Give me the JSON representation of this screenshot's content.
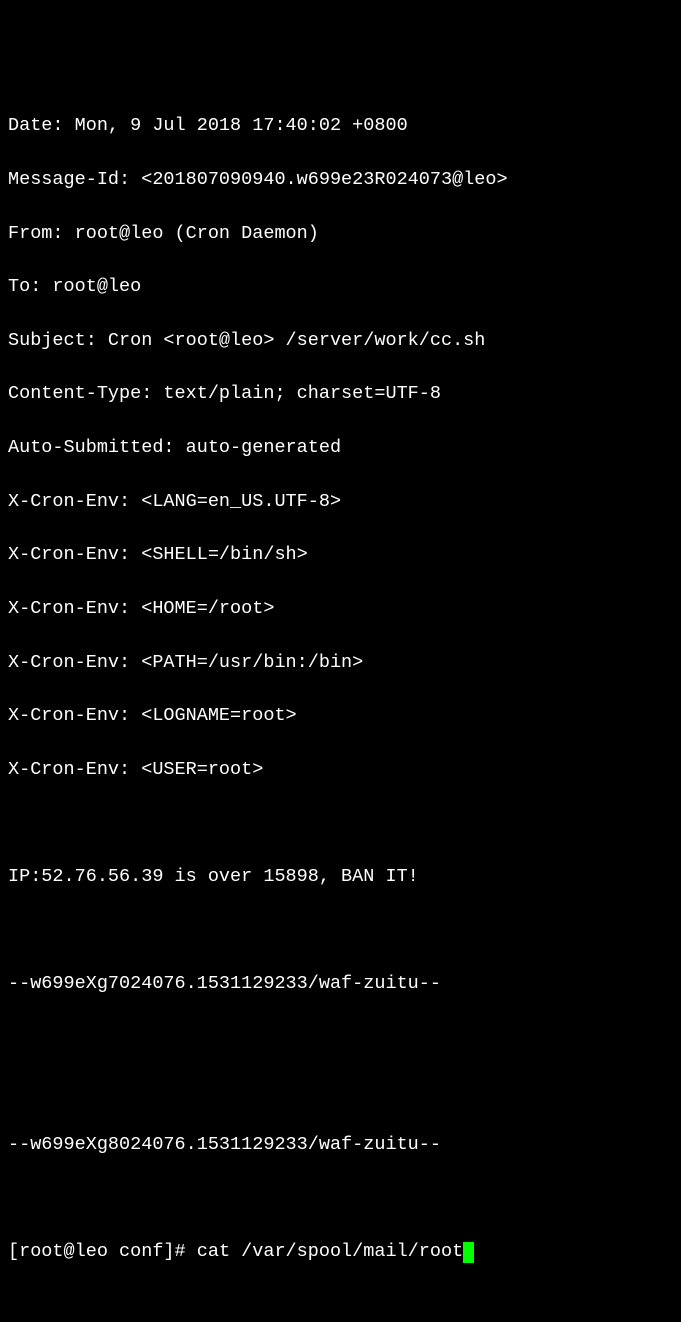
{
  "headers": {
    "date": "Date: Mon, 9 Jul 2018 17:40:02 +0800",
    "message_id": "Message-Id: <201807090940.w699e23R024073@leo>",
    "from": "From: root@leo (Cron Daemon)",
    "to": "To: root@leo",
    "subject": "Subject: Cron <root@leo> /server/work/cc.sh",
    "content_type": "Content-Type: text/plain; charset=UTF-8",
    "auto_submitted": "Auto-Submitted: auto-generated",
    "xcron_lang": "X-Cron-Env: <LANG=en_US.UTF-8>",
    "xcron_shell": "X-Cron-Env: <SHELL=/bin/sh>",
    "xcron_home": "X-Cron-Env: <HOME=/root>",
    "xcron_path": "X-Cron-Env: <PATH=/usr/bin:/bin>",
    "xcron_logname": "X-Cron-Env: <LOGNAME=root>",
    "xcron_user": "X-Cron-Env: <USER=root>"
  },
  "body": {
    "alert": "IP:52.76.56.39 is over 15898, BAN IT!",
    "boundary1": "--w699eXg7024076.1531129233/waf-zuitu--",
    "boundary2": "--w699eXg8024076.1531129233/waf-zuitu--"
  },
  "prompt": {
    "ps1": "[root@leo conf]# ",
    "command": "cat /var/spool/mail/root"
  }
}
